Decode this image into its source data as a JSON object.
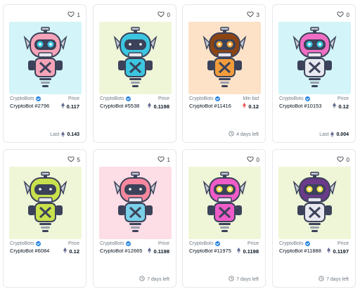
{
  "cards": [
    {
      "likes": "1",
      "collection": "CryptoBots",
      "name": "CryptoBot #2796",
      "price_label": "Price",
      "price": "0.117",
      "eth_color": "#62688f",
      "footer_label": "Last",
      "footer_value": "0.143",
      "footer_type": "last",
      "bg": "#d3f4f9",
      "body": "#f5a3b8",
      "eye": "#3cc6e0",
      "dark": "#3b4259",
      "belly": "#f5a3b8"
    },
    {
      "likes": "0",
      "collection": "CryptoBots",
      "name": "CryptoBot #5538",
      "price_label": "Price",
      "price": "0.1198",
      "eth_color": "#62688f",
      "footer_label": "",
      "footer_value": "",
      "footer_type": "none",
      "bg": "#eff6d8",
      "body": "#3cc6e0",
      "eye": "#3b4259",
      "dark": "#3b4259",
      "belly": "#3cc6e0"
    },
    {
      "likes": "3",
      "collection": "CryptoBots",
      "name": "CryptoBot #11416",
      "price_label": "Min bid",
      "price": "0.12",
      "eth_color": "#eb5757",
      "footer_label": "4 days left",
      "footer_value": "",
      "footer_type": "time",
      "bg": "#fde2c8",
      "body": "#8b4513",
      "eye": "#e8a33a",
      "dark": "#3b4259",
      "belly": "#f39c3c"
    },
    {
      "likes": "0",
      "collection": "CryptoBots",
      "name": "CryptoBot #10153",
      "price_label": "Price",
      "price": "0.12",
      "eth_color": "#62688f",
      "footer_label": "Last",
      "footer_value": "0.004",
      "footer_type": "last",
      "bg": "#d3f4f9",
      "body": "#ef6ec4",
      "eye": "#3cc6e0",
      "dark": "#3b4259",
      "belly": "#e8e8f0"
    },
    {
      "likes": "5",
      "collection": "CryptoBots",
      "name": "CryptoBot #6084",
      "price_label": "Price",
      "price": "0.12",
      "eth_color": "#62688f",
      "footer_label": "",
      "footer_value": "",
      "footer_type": "none",
      "bg": "#eff6d8",
      "body": "#c9e14c",
      "eye": "#3b4259",
      "dark": "#3b4259",
      "belly": "#c9e14c"
    },
    {
      "likes": "1",
      "collection": "CryptoBots",
      "name": "CryptoBot #12665",
      "price_label": "Price",
      "price": "0.1198",
      "eth_color": "#62688f",
      "footer_label": "7 days left",
      "footer_value": "",
      "footer_type": "time",
      "bg": "#fddde6",
      "body": "#f5889e",
      "eye": "#3b4259",
      "dark": "#3b4259",
      "belly": "#7ad0e8"
    },
    {
      "likes": "0",
      "collection": "CryptoBots",
      "name": "CryptoBot #11975",
      "price_label": "Price",
      "price": "0.1198",
      "eth_color": "#62688f",
      "footer_label": "7 days left",
      "footer_value": "",
      "footer_type": "time",
      "bg": "#eff6d8",
      "body": "#ef5cc8",
      "eye": "#f2e04a",
      "dark": "#3b4259",
      "belly": "#ef5cc8"
    },
    {
      "likes": "0",
      "collection": "CryptoBots",
      "name": "CryptoBot #11888",
      "price_label": "Price",
      "price": "0.1197",
      "eth_color": "#62688f",
      "footer_label": "7 days left",
      "footer_value": "",
      "footer_type": "time",
      "bg": "#eff6d8",
      "body": "#6b3a8a",
      "eye": "#f2e04a",
      "dark": "#3b4259",
      "belly": "#e8e8f0"
    }
  ]
}
